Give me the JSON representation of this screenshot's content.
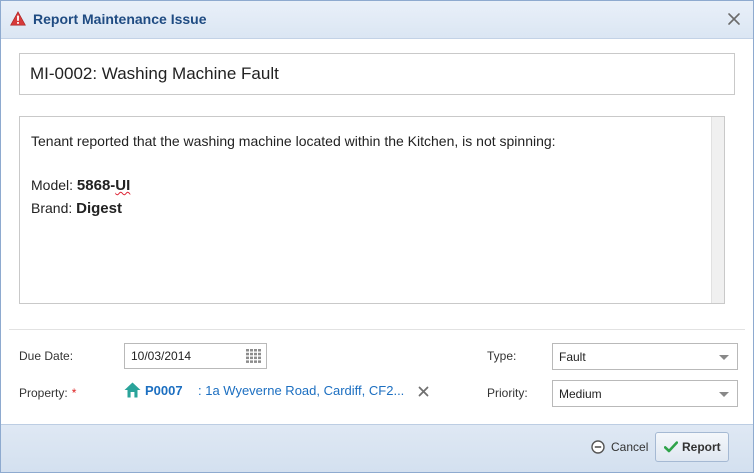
{
  "dialog": {
    "title": "Report Maintenance Issue",
    "icon": "warning-triangle-icon",
    "close_icon": "close-icon"
  },
  "subject": {
    "value": "MI-0002: Washing Machine Fault"
  },
  "description": {
    "intro": "Tenant reported that the washing machine located within the Kitchen, is not spinning:",
    "model_label": "Model: ",
    "model_value_main": "5868-",
    "model_value_misspelled": "UI",
    "brand_label": "Brand: ",
    "brand_value": "Digest"
  },
  "form": {
    "due_date": {
      "label": "Due Date:",
      "value": "10/03/2014",
      "icon": "calendar-icon"
    },
    "property": {
      "label": "Property:",
      "required_marker": "*",
      "code": "P0007",
      "address": ": 1a Wyeverne Road, Cardiff, CF2...",
      "icon": "home-icon",
      "clear_icon": "clear-icon"
    },
    "type": {
      "label": "Type:",
      "value": "Fault"
    },
    "priority": {
      "label": "Priority:",
      "value": "Medium"
    }
  },
  "footer": {
    "cancel_label": "Cancel",
    "report_label": "Report"
  },
  "colors": {
    "title_text": "#1f4b82",
    "link": "#1c6fc1",
    "required": "#dd2222",
    "warning": "#d63a3a",
    "accent_green": "#2fa34a"
  }
}
